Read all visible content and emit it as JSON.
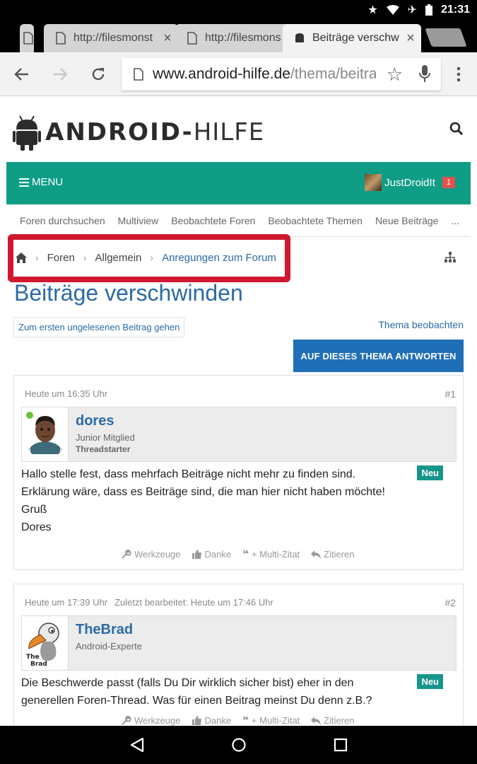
{
  "status": {
    "time": "21:31"
  },
  "tabs": [
    {
      "title": ""
    },
    {
      "title": "http://filesmonst"
    },
    {
      "title": "http://filesmons"
    },
    {
      "title": "Beiträge verschw"
    }
  ],
  "address": {
    "domain": "www.android-hilfe.de",
    "path": "/thema/beitrag"
  },
  "site": {
    "logo_bold": "ANDROID-",
    "logo_light": "HILFE",
    "menu_label": "MENU",
    "username": "JustDroidIt",
    "notification_count": "1",
    "accent_color": "#0f9d86"
  },
  "subnav": [
    "Foren durchsuchen",
    "Multiview",
    "Beobachtete Foren",
    "Beobachtete Themen",
    "Neue Beiträge",
    "..."
  ],
  "breadcrumb": [
    "Foren",
    "Allgemein",
    "Anregungen zum Forum"
  ],
  "thread": {
    "title": "Beiträge verschwinden",
    "unread_label": "Zum ersten ungelesenen Beitrag gehen",
    "watch_label": "Thema beobachten",
    "reply_label": "AUF DIESES THEMA ANTWORTEN"
  },
  "posts": [
    {
      "time": "Heute um 16:35 Uhr",
      "edited": "",
      "number": "#1",
      "author": "dores",
      "role": "Junior Mitglied",
      "badge": "Threadstarter",
      "new_label": "Neu",
      "body": [
        "Hallo stelle fest, dass mehrfach Beiträge nicht mehr zu finden sind.",
        "Erklärung wäre, dass es Beiträge sind, die man hier nicht haben möchte!",
        "Gruß",
        "Dores"
      ]
    },
    {
      "time": "Heute um 17:39 Uhr",
      "edited": "Zuletzt bearbeitet: Heute um 17:46 Uhr",
      "number": "#2",
      "author": "TheBrad",
      "role": "Android-Experte",
      "badge": "",
      "new_label": "Neu",
      "body": [
        "Die Beschwerde passt (falls Du Dir wirklich sicher bist) eher in den",
        "generellen Foren-Thread. Was für einen Beitrag meinst Du denn z.B.?"
      ]
    }
  ],
  "post_actions": [
    "Werkzeuge",
    "Danke",
    "+ Multi-Zitat",
    "Zitieren"
  ]
}
